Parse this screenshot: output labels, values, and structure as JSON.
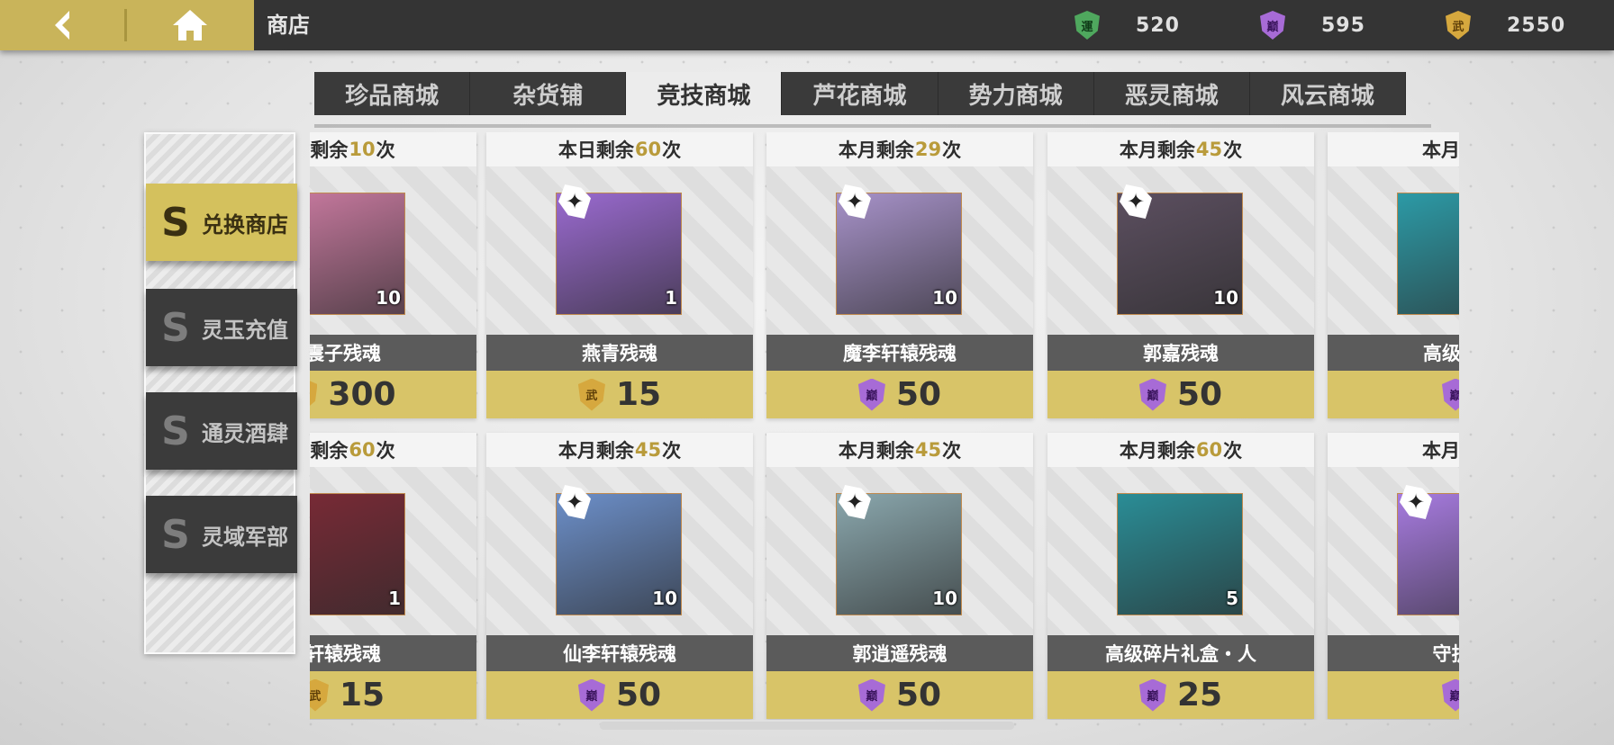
{
  "header": {
    "title": "商店",
    "currencies": [
      {
        "icon": "yun-token-icon",
        "glyph": "運",
        "value": "520",
        "color": "#4fa85e"
      },
      {
        "icon": "dian-token-icon",
        "glyph": "巅",
        "value": "595",
        "color": "#a76bd6"
      },
      {
        "icon": "wu-token-icon",
        "glyph": "武",
        "value": "2550",
        "color": "#d6a83e"
      }
    ]
  },
  "tabs": [
    "珍品商城",
    "杂货铺",
    "竞技商城",
    "芦花商城",
    "势力商城",
    "恶灵商城",
    "风云商城"
  ],
  "active_tab": "竞技商城",
  "sidebar": {
    "items": [
      {
        "label": "兑换商店",
        "active": true
      },
      {
        "label": "灵玉充值",
        "active": false
      },
      {
        "label": "通灵酒肆",
        "active": false
      },
      {
        "label": "灵域军部",
        "active": false
      }
    ]
  },
  "cards": [
    {
      "limit_pre": "月剩余",
      "limit_num": "10",
      "limit_post": "次",
      "name": "震子残魂",
      "qty": "10",
      "price": "300",
      "currency": "武",
      "shard": false,
      "art": "#c97aa0"
    },
    {
      "limit_pre": "本日剩余",
      "limit_num": "60",
      "limit_post": "次",
      "name": "燕青残魂",
      "qty": "1",
      "price": "15",
      "currency": "武",
      "shard": true,
      "art": "#9a6ad0"
    },
    {
      "limit_pre": "本月剩余",
      "limit_num": "29",
      "limit_post": "次",
      "name": "魔李轩辕残魂",
      "qty": "10",
      "price": "50",
      "currency": "巅",
      "shard": true,
      "art": "#a792c9"
    },
    {
      "limit_pre": "本月剩余",
      "limit_num": "45",
      "limit_post": "次",
      "name": "郭嘉残魂",
      "qty": "10",
      "price": "50",
      "currency": "巅",
      "shard": true,
      "art": "#5c4f60"
    },
    {
      "limit_pre": "本月剩余",
      "limit_num": "",
      "limit_post": "",
      "name": "高级碎片",
      "qty": "",
      "price": "",
      "currency": "巅",
      "shard": false,
      "art": "#2c9aa6"
    },
    {
      "limit_pre": "月剩余",
      "limit_num": "60",
      "limit_post": "次",
      "name": "轩辕残魂",
      "qty": "1",
      "price": "15",
      "currency": "武",
      "shard": false,
      "art": "#7b2a36"
    },
    {
      "limit_pre": "本月剩余",
      "limit_num": "45",
      "limit_post": "次",
      "name": "仙李轩辕残魂",
      "qty": "10",
      "price": "50",
      "currency": "巅",
      "shard": true,
      "art": "#6c8fc9"
    },
    {
      "limit_pre": "本月剩余",
      "limit_num": "45",
      "limit_post": "次",
      "name": "郭逍遥残魂",
      "qty": "10",
      "price": "50",
      "currency": "巅",
      "shard": true,
      "art": "#8aa7ad"
    },
    {
      "limit_pre": "本月剩余",
      "limit_num": "60",
      "limit_post": "次",
      "name": "高级碎片礼盒・人",
      "qty": "5",
      "price": "25",
      "currency": "巅",
      "shard": false,
      "art": "#2a8d96"
    },
    {
      "limit_pre": "本月剩余",
      "limit_num": "",
      "limit_post": "",
      "name": "守护灵",
      "qty": "",
      "price": "",
      "currency": "巅",
      "shard": true,
      "art": "#a77be0"
    }
  ]
}
